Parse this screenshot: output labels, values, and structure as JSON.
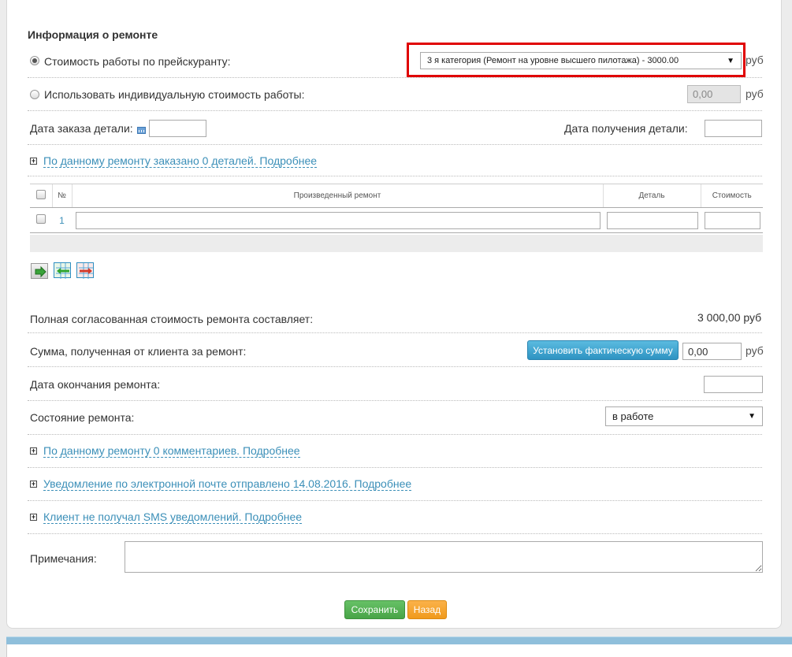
{
  "section_title": "Информация о ремонте",
  "price_list": {
    "label": "Стоимость работы по прейскуранту:",
    "selected": "3 я категория (Ремонт на уровне высшего пилотажа) - 3000.00",
    "unit": "руб"
  },
  "custom_price": {
    "label": "Использовать индивидуальную стоимость работы:",
    "value": "0,00",
    "unit": "руб"
  },
  "order_date": {
    "label": "Дата заказа детали:",
    "value": ""
  },
  "receive_date": {
    "label": "Дата получения детали:",
    "value": ""
  },
  "parts_link": "По данному ремонту заказано 0 деталей. Подробнее",
  "table": {
    "col_num": "№",
    "col_repair": "Произведенный ремонт",
    "col_part": "Деталь",
    "col_cost": "Стоимость",
    "rows": [
      {
        "num": "1"
      }
    ]
  },
  "toolbar_icons": [
    "import-icon",
    "add-row-icon",
    "remove-row-icon"
  ],
  "total": {
    "label": "Полная согласованная стоимость ремонта составляет:",
    "value": "3 000,00 руб"
  },
  "received": {
    "label": "Сумма, полученная от клиента за ремонт:",
    "button": "Установить фактическую сумму",
    "value": "0,00",
    "unit": "руб"
  },
  "end_date": {
    "label": "Дата окончания ремонта:",
    "value": ""
  },
  "status": {
    "label": "Состояние ремонта:",
    "selected": "в работе"
  },
  "comments_link": "По данному ремонту 0 комментариев. Подробнее",
  "email_link": "Уведомление по электронной почте отправлено 14.08.2016. Подробнее",
  "sms_link": "Клиент не получал SMS уведомлений. Подробнее",
  "notes": {
    "label": "Примечания:",
    "value": ""
  },
  "buttons": {
    "save": "Сохранить",
    "back": "Назад"
  },
  "colors": {
    "highlight": "#e00000",
    "link": "#3b8fb8",
    "save": "#48a447",
    "back": "#f09a1c",
    "action": "#2e93c2"
  }
}
